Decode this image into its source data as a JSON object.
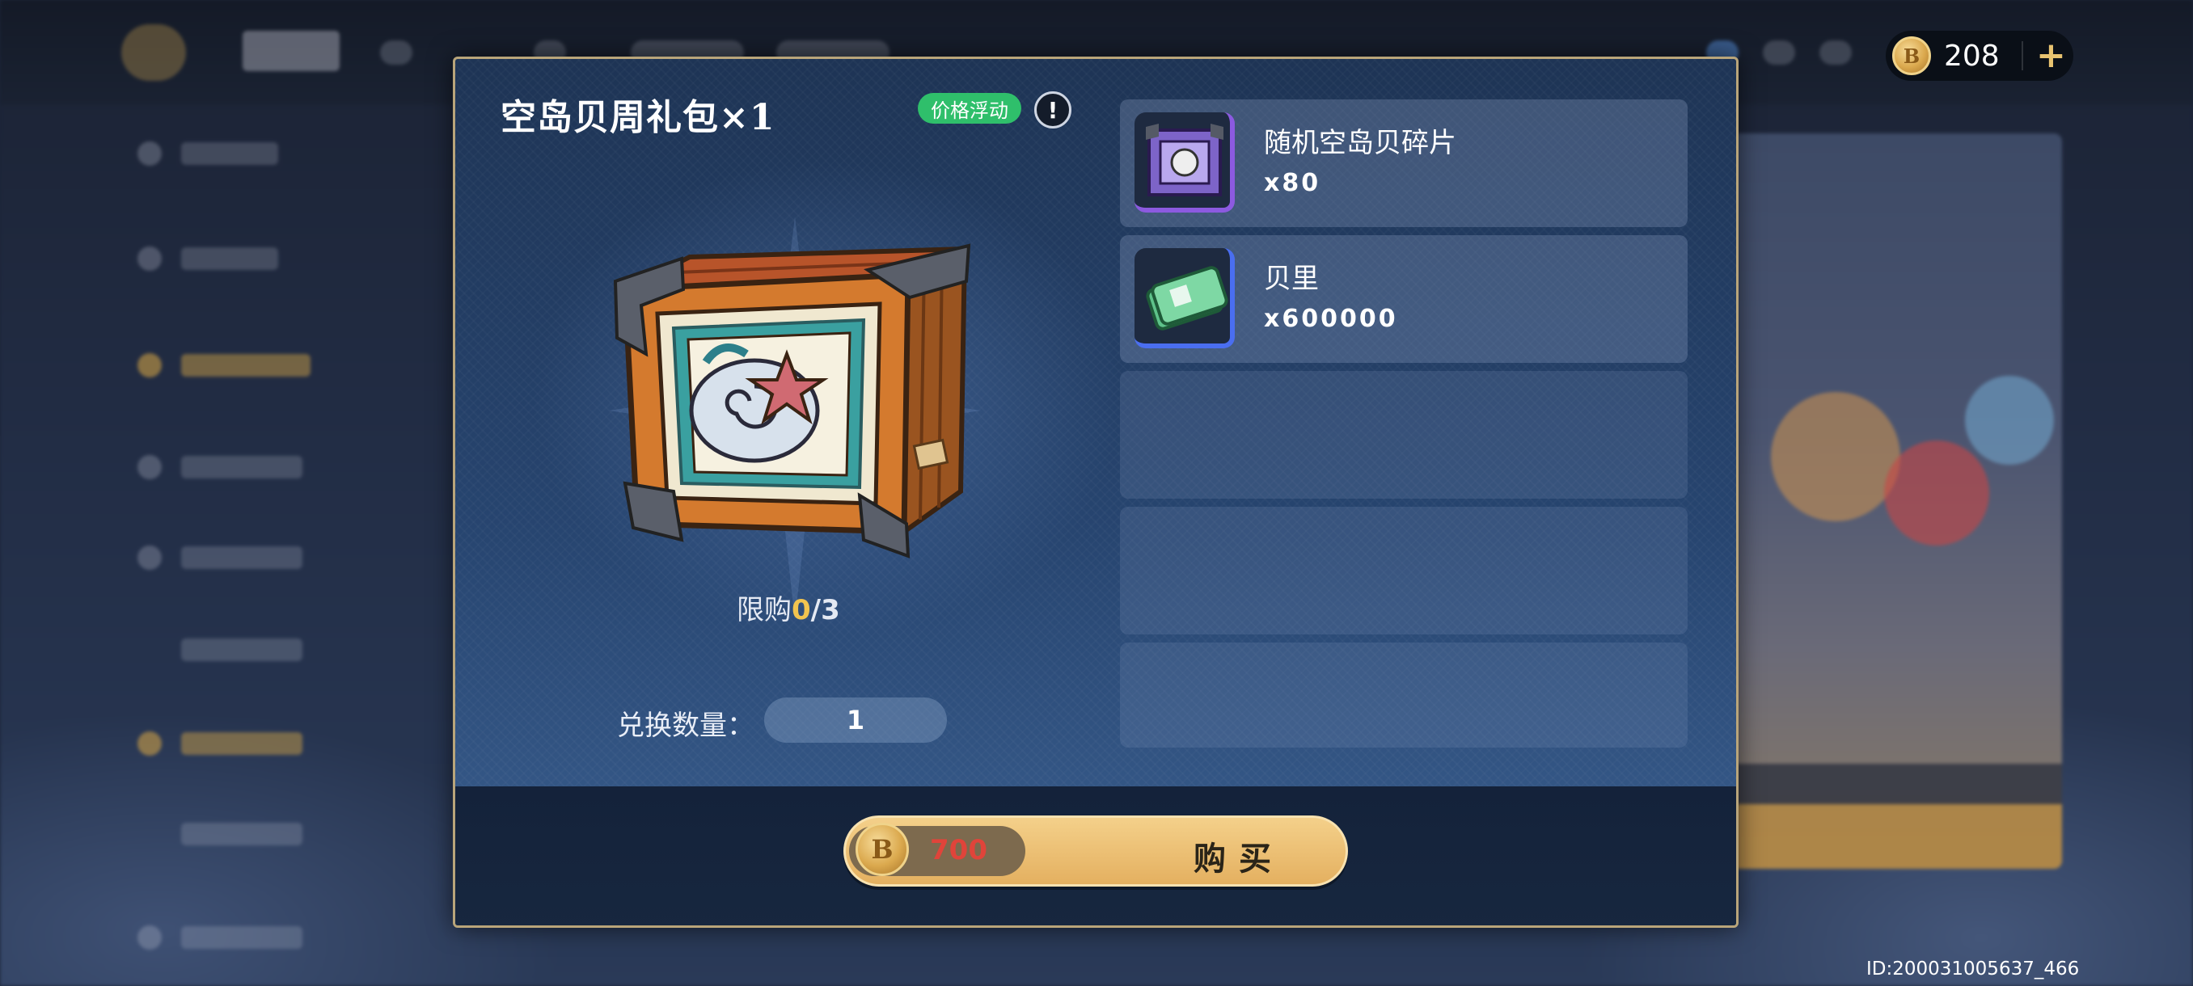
{
  "currency": {
    "amount": "208",
    "coin_symbol": "B",
    "add_label": "+"
  },
  "pack": {
    "title": "空岛贝周礼包×1",
    "price_tag": "价格浮动",
    "info_icon": "!",
    "limit_label": "限购",
    "limit_current": "0",
    "limit_total": "/3",
    "quantity_label": "兑换数量：",
    "quantity_value": "1"
  },
  "rewards": [
    {
      "name": "随机空岛贝碎片",
      "count": "x80",
      "icon": "shell-fragment-box-icon"
    },
    {
      "name": "贝里",
      "count": "x600000",
      "icon": "berry-cash-icon"
    }
  ],
  "buy": {
    "price": "700",
    "label": "购买",
    "coin_symbol": "B"
  },
  "footer": {
    "id_text": "ID:200031005637_466"
  },
  "colors": {
    "accent_gold": "#e4b060",
    "price_red": "#e0443a",
    "tag_green": "#2fbf6b",
    "limit_highlight": "#f2c44f"
  }
}
